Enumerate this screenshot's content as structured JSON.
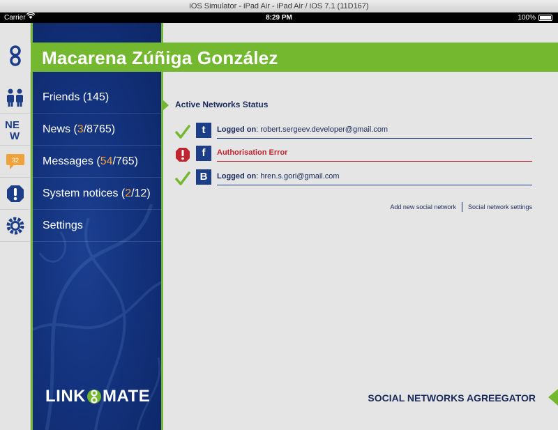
{
  "window": {
    "title": "iOS Simulator - iPad Air - iPad Air / iOS 7.1 (11D167)"
  },
  "status_bar": {
    "carrier": "Carrier",
    "time": "8:29 PM",
    "battery": "100%"
  },
  "rail": {
    "items": [
      {
        "icon": "link-icon"
      },
      {
        "icon": "friends-icon"
      },
      {
        "icon": "news-icon",
        "label": "NEW"
      },
      {
        "icon": "messages-icon",
        "badge": "32"
      },
      {
        "icon": "notice-icon"
      },
      {
        "icon": "settings-icon"
      }
    ]
  },
  "profile": {
    "name": "Macarena Zúñiga González"
  },
  "nav": {
    "friends": {
      "label": "Friends",
      "count": "(145)"
    },
    "news": {
      "label": "News",
      "new": "3",
      "total": "/8765)"
    },
    "messages": {
      "label": "Messages",
      "new": "54",
      "total": "/765)"
    },
    "notices": {
      "label": "System notices",
      "new": "2",
      "total": "/12)"
    },
    "settings": {
      "label": "Settings"
    }
  },
  "logo": {
    "left": "LINK",
    "right": "MATE"
  },
  "main": {
    "section_title": "Active Networks Status",
    "networks": [
      {
        "logo": "t",
        "status": "ok",
        "label": "Logged on",
        "value": ": robert.sergeev.developer@gmail.com"
      },
      {
        "logo": "f",
        "status": "error",
        "label": "Authorisation Error",
        "value": ""
      },
      {
        "logo": "B",
        "status": "ok",
        "label": "Logged on",
        "value": ": hren.s.gori@gmail.com"
      }
    ],
    "links": {
      "add": "Add new social network",
      "settings": "Social network settings"
    },
    "footer": "SOCIAL NETWORKS AGREEGATOR"
  },
  "colors": {
    "green": "#73b82f",
    "navy": "#12307a",
    "error": "#c0262f",
    "highlight": "#f0a23a"
  }
}
